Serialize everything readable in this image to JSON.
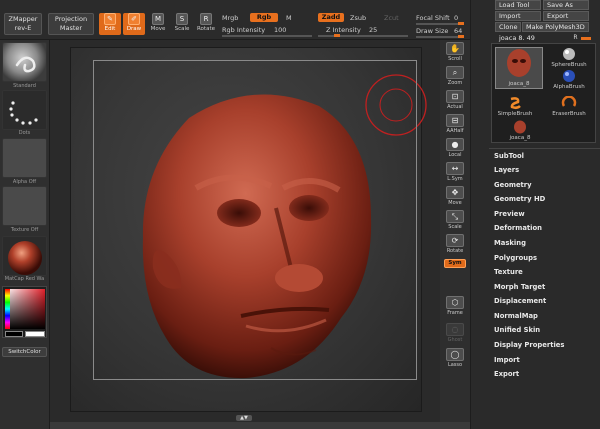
{
  "topbar": {
    "zmapper_title": "ZMapper",
    "zmapper_sub": "rev-E",
    "projection_title": "Projection",
    "projection_sub": "Master",
    "tools": [
      {
        "label": "Edit",
        "glyph": "✎",
        "active": true
      },
      {
        "label": "Draw",
        "glyph": "✐",
        "active": true
      },
      {
        "label": "Move",
        "glyph": "M",
        "active": false
      },
      {
        "label": "Scale",
        "glyph": "S",
        "active": false
      },
      {
        "label": "Rotate",
        "glyph": "R",
        "active": false
      }
    ],
    "mrgb": "Mrgb",
    "rgb": "Rgb",
    "m": "M",
    "rgb_intensity_label": "Rgb Intensity",
    "rgb_intensity_value": "100",
    "zadd": "Zadd",
    "zsub": "Zsub",
    "zcut": "Zcut",
    "z_intensity_label": "Z Intensity",
    "z_intensity_value": "25",
    "focal_shift_label": "Focal Shift",
    "focal_shift_value": "0",
    "draw_size_label": "Draw Size",
    "draw_size_value": "64"
  },
  "left_shelf": {
    "standard": "Standard",
    "dots": "Dots",
    "alpha_off": "Alpha Off",
    "texture_off": "Texture Off",
    "matcap": "MatCap Red Wa",
    "switch_color": "SwitchColor"
  },
  "right_strip": [
    {
      "label": "Scroll",
      "glyph": "✋",
      "active": false,
      "faded": false
    },
    {
      "label": "Zoom",
      "glyph": "⌕",
      "active": false,
      "faded": false
    },
    {
      "label": "Actual",
      "glyph": "⊡",
      "active": false,
      "faded": false
    },
    {
      "label": "AAHalf",
      "glyph": "⊟",
      "active": false,
      "faded": false
    },
    {
      "label": "Local",
      "glyph": "●",
      "active": false,
      "faded": false
    },
    {
      "label": "L.Sym",
      "glyph": "↔",
      "active": false,
      "faded": false
    },
    {
      "label": "Move",
      "glyph": "✥",
      "active": false,
      "faded": false
    },
    {
      "label": "Scale",
      "glyph": "⤡",
      "active": false,
      "faded": false
    },
    {
      "label": "Rotate",
      "glyph": "⟳",
      "active": false,
      "faded": false
    },
    {
      "label": "Frame",
      "glyph": "⬡",
      "active": false,
      "faded": false
    },
    {
      "label": "Ghost",
      "glyph": "◌",
      "active": false,
      "faded": true
    },
    {
      "label": "Lasso",
      "glyph": "◯",
      "active": false,
      "faded": false
    }
  ],
  "right_strip_xyz": "Sym",
  "right_panel": {
    "load_tool": "Load Tool",
    "save_as": "Save As",
    "import": "Import",
    "export": "Export",
    "clone": "Clone",
    "make_polymesh": "Make PolyMesh3D",
    "tool_name": "joaca 8. 49",
    "tool_r": "R",
    "toolbox": [
      {
        "label": "joaca_8",
        "kind": "head"
      },
      {
        "label": "SphereBrush",
        "kind": "sphere"
      },
      {
        "label": "AlphaBrush",
        "kind": "alpha"
      },
      {
        "label": "SimpleBrush",
        "kind": "simple"
      },
      {
        "label": "EraserBrush",
        "kind": "eraser"
      },
      {
        "label": "joaca_8",
        "kind": "head-small"
      }
    ],
    "menu": [
      "SubTool",
      "Layers",
      "Geometry",
      "Geometry HD",
      "Preview",
      "Deformation",
      "Masking",
      "Polygroups",
      "Texture",
      "Morph Target",
      "Displacement",
      "NormalMap",
      "Unified Skin",
      "Display Properties",
      "Import",
      "Export"
    ]
  },
  "colors": {
    "accent": "#e8701e",
    "skin": "#a8402c",
    "panel": "#2a2a2a"
  }
}
